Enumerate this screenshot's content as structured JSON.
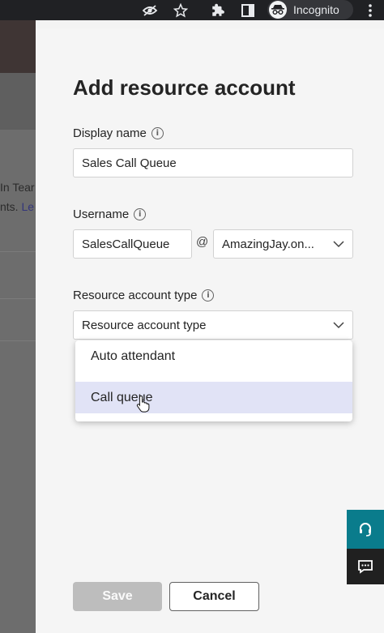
{
  "browser": {
    "incognito_label": "Incognito",
    "icons": [
      "eye-off-icon",
      "star-icon",
      "extensions-icon",
      "sidebar-icon",
      "incognito-icon",
      "more-vert-icon"
    ]
  },
  "background_page": {
    "line1": "In Tear",
    "line2_text": "nts. ",
    "line2_link": "Le"
  },
  "panel": {
    "title": "Add resource account",
    "display_name": {
      "label": "Display name",
      "value": "Sales Call Queue"
    },
    "username": {
      "label": "Username",
      "value": "SalesCallQueue",
      "at": "@",
      "domain": "AmazingJay.on..."
    },
    "resource_type": {
      "label": "Resource account type",
      "placeholder": "Resource account type",
      "options": [
        "Auto attendant",
        "Call queue"
      ],
      "highlighted": "Call queue"
    },
    "buttons": {
      "save": "Save",
      "cancel": "Cancel"
    }
  },
  "colors": {
    "accent_teal": "#0a7c8c",
    "highlight": "#e1e3f6"
  }
}
